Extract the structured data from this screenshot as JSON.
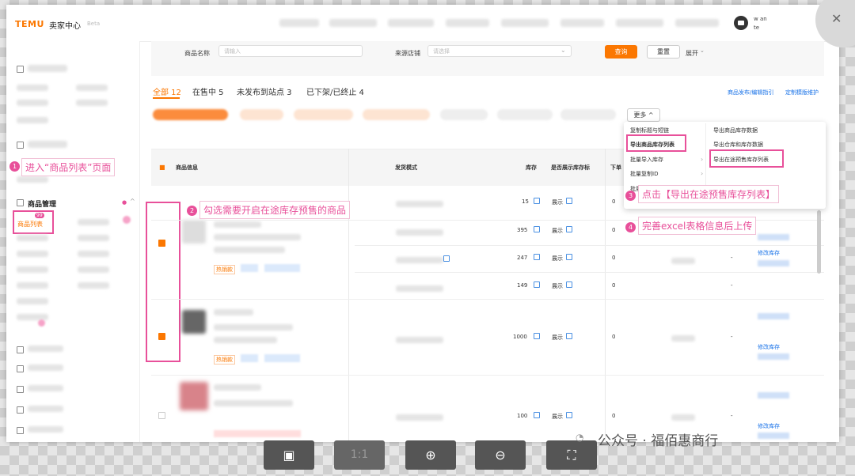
{
  "topbar": {
    "logo": "TEMU",
    "app_title": "卖家中心",
    "beta_tag": "Beta",
    "user_line1": "w                         an",
    "user_line2": "te"
  },
  "sidebar": {
    "section_title": "商品管理",
    "active_item": "商品列表",
    "active_badge": "99"
  },
  "filters": {
    "name_label": "商品名称",
    "name_placeholder": "请输入",
    "store_label": "来源店铺",
    "store_placeholder": "请选择",
    "query_button": "查询",
    "reset_button": "重置",
    "expand_button": "展开"
  },
  "tabs": [
    {
      "label": "全部 12"
    },
    {
      "label": "在售中 5"
    },
    {
      "label": "未发布到站点 3"
    },
    {
      "label": "已下架/已终止 4"
    }
  ],
  "right_links": {
    "guide": "商品发布/编辑指引",
    "template": "定制模版维护"
  },
  "more_button": "更多",
  "dropdown": {
    "left": [
      "复制标题与短链",
      "导出商品库存列表",
      "批量导入库存",
      "批量复制ID",
      "批量关闭预售"
    ],
    "right": [
      "导出商品库存数据",
      "导出仓库和库存数据",
      "导出在途预售库存列表"
    ]
  },
  "table": {
    "headers": {
      "info": "商品信息",
      "mode": "发货模式",
      "stock": "库存",
      "show": "是否展示库存标",
      "next": "下单"
    },
    "rows": [
      {
        "stock": "15",
        "show": "展示",
        "zero": "0",
        "hot": "",
        "edit": ""
      },
      {
        "stock": "395",
        "show": "展示",
        "zero": "0",
        "hot": "",
        "edit": ""
      },
      {
        "stock": "247",
        "show": "展示",
        "zero": "0",
        "hot": "热销款",
        "edit": "修改库存"
      },
      {
        "stock": "149",
        "show": "展示",
        "zero": "0",
        "hot": "",
        "edit": ""
      },
      {
        "stock": "1000",
        "show": "展示",
        "zero": "0",
        "hot": "热销款",
        "edit": "修改库存"
      },
      {
        "stock": "100",
        "show": "展示",
        "zero": "0",
        "hot": "",
        "edit": "修改库存"
      }
    ]
  },
  "annotations": {
    "step1": {
      "num": "1",
      "text": "进入“商品列表”页面"
    },
    "step2": {
      "num": "2",
      "text": "勾选需要开启在途库存预售的商品"
    },
    "step3": {
      "num": "3",
      "text": "点击【导出在途预售库存列表】"
    },
    "step4": {
      "num": "4",
      "text": "完善excel表格信息后上传"
    }
  },
  "toolbar": {
    "zoom_label": "1:1"
  },
  "watermark": "公众号 · 福佰惠商行",
  "colors": {
    "accent": "#fb7701",
    "annotation": "#e8509a",
    "link": "#1a73e8"
  }
}
